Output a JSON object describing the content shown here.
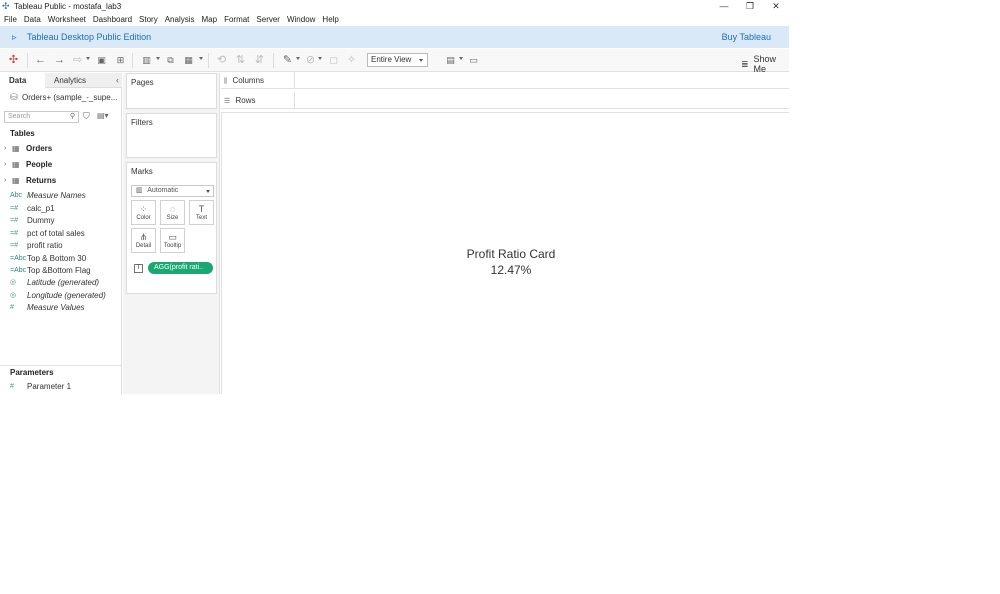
{
  "window": {
    "title": "Tableau Public - mostafa_lab3",
    "controls": [
      "—",
      "❐",
      "✕"
    ]
  },
  "menu": [
    "File",
    "Data",
    "Worksheet",
    "Dashboard",
    "Story",
    "Analysis",
    "Map",
    "Format",
    "Server",
    "Window",
    "Help"
  ],
  "banner": {
    "edition": "Tableau Desktop Public Edition",
    "buy": "Buy Tableau"
  },
  "toolbar": {
    "fit": "Entire View",
    "show_me": "Show Me"
  },
  "data_pane": {
    "tabs": [
      "Data",
      "Analytics"
    ],
    "datasource": "Orders+ (sample_-_supe...",
    "search_placeholder": "Search",
    "tables_heading": "Tables",
    "tables": [
      "Orders",
      "People",
      "Returns"
    ],
    "fields": [
      {
        "label": "Measure Names",
        "icon": "Abc",
        "italic": true
      },
      {
        "label": "calc_p1",
        "icon": "=#",
        "italic": false
      },
      {
        "label": "Dummy",
        "icon": "=#",
        "italic": false
      },
      {
        "label": "pct of total sales",
        "icon": "=#",
        "italic": false
      },
      {
        "label": "profit ratio",
        "icon": "=#",
        "italic": false
      },
      {
        "label": "Top & Bottom 30",
        "icon": "=Abc",
        "italic": false
      },
      {
        "label": "Top &Bottom Flag",
        "icon": "=Abc",
        "italic": false
      },
      {
        "label": "Latitude (generated)",
        "icon": "◎",
        "italic": true
      },
      {
        "label": "Longitude (generated)",
        "icon": "◎",
        "italic": true
      },
      {
        "label": "Measure Values",
        "icon": "#",
        "italic": true
      }
    ],
    "parameters_heading": "Parameters",
    "parameters": [
      {
        "label": "Parameter 1",
        "icon": "#"
      }
    ]
  },
  "cards": {
    "pages": "Pages",
    "filters": "Filters",
    "marks": "Marks",
    "mark_type": "Automatic",
    "mark_buttons": [
      {
        "label": "Color",
        "icon": "color-icon"
      },
      {
        "label": "Size",
        "icon": "size-icon"
      },
      {
        "label": "Text",
        "icon": "text-icon"
      },
      {
        "label": "Detail",
        "icon": "detail-icon"
      },
      {
        "label": "Tooltip",
        "icon": "tooltip-icon"
      }
    ],
    "pill": "AGG(profit rati..",
    "pill_color": "#1aa872"
  },
  "shelves": {
    "columns": "Columns",
    "rows": "Rows"
  },
  "view": {
    "title": "Profit Ratio Card",
    "value": "12.47%"
  },
  "colors": {
    "banner_bg": "#d9e9f7",
    "accent": "#1f6fb4"
  }
}
